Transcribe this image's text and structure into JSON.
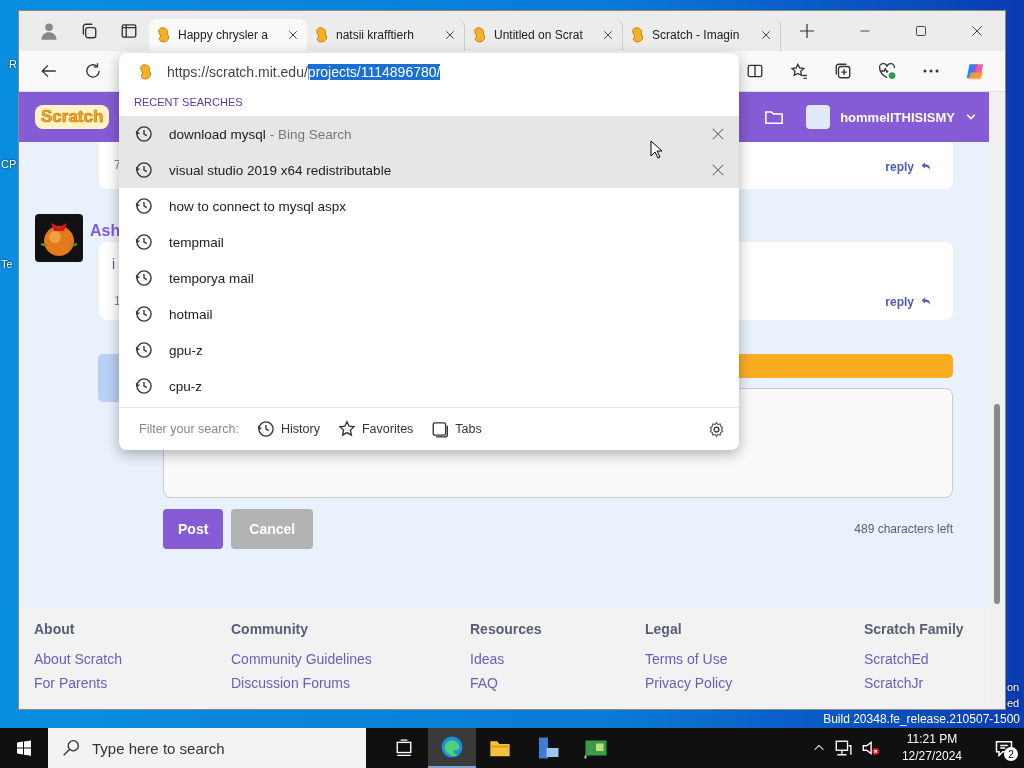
{
  "desktop": {
    "icon_labels": [
      "R",
      "CP",
      "Te"
    ],
    "activation_lines": [
      "on",
      "ed"
    ],
    "build": "Build 20348.fe_release.210507-1500"
  },
  "browser": {
    "tabs": [
      {
        "title": "Happy chrysler a",
        "selected": true
      },
      {
        "title": "natsii krafftierh",
        "selected": false
      },
      {
        "title": "Untitled on Scrat",
        "selected": false
      },
      {
        "title": "Scratch - Imagin",
        "selected": false
      }
    ],
    "address": {
      "base": "https://scratch.mit.edu/",
      "selected_text": "projects/1114896780/"
    }
  },
  "suggestions": {
    "heading": "RECENT SEARCHES",
    "items": [
      {
        "text": "download mysql",
        "source": "- Bing Search",
        "selected": true
      },
      {
        "text": "visual studio 2019 x64 redistributable",
        "selected": true
      },
      {
        "text": "how to connect to mysql aspx",
        "selected": false
      },
      {
        "text": "tempmail",
        "selected": false
      },
      {
        "text": "temporya mail",
        "selected": false
      },
      {
        "text": "hotmail",
        "selected": false
      },
      {
        "text": "gpu-z",
        "selected": false
      },
      {
        "text": "cpu-z",
        "selected": false
      }
    ],
    "filter_label": "Filter your search:",
    "filters": [
      {
        "label": "History",
        "kind": "history"
      },
      {
        "label": "Favorites",
        "kind": "favorites"
      },
      {
        "label": "Tabs",
        "kind": "tabs"
      }
    ]
  },
  "page": {
    "logo": "Scratch",
    "username": "hommellTHISISMY",
    "comments": [
      {
        "meta": "7",
        "reply": "reply"
      },
      {
        "author": "Ash",
        "body": "i",
        "meta": "1",
        "reply": "reply"
      }
    ],
    "compose": {
      "post": "Post",
      "cancel": "Cancel",
      "remaining": "489 characters left"
    },
    "footer": [
      {
        "heading": "About",
        "links": [
          "About Scratch",
          "For Parents"
        ]
      },
      {
        "heading": "Community",
        "links": [
          "Community Guidelines",
          "Discussion Forums"
        ]
      },
      {
        "heading": "Resources",
        "links": [
          "Ideas",
          "FAQ"
        ]
      },
      {
        "heading": "Legal",
        "links": [
          "Terms of Use",
          "Privacy Policy"
        ]
      },
      {
        "heading": "Scratch Family",
        "links": [
          "ScratchEd",
          "ScratchJr"
        ]
      }
    ]
  },
  "taskbar": {
    "search_placeholder": "Type here to search",
    "time": "11:21 PM",
    "date": "12/27/2024",
    "notifications": "2"
  }
}
